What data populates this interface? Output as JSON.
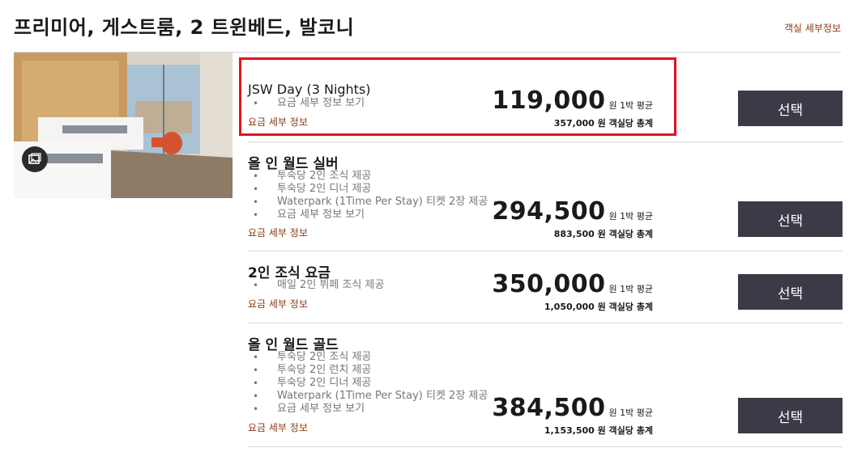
{
  "room": {
    "title": "프리미어, 게스트룸, 2 트윈베드, 발코니",
    "details_link": "객실 세부정보",
    "photo_icon": "gallery-icon"
  },
  "rates": [
    {
      "name": "JSW Day (3 Nights)",
      "inclusions": [
        "요금 세부 정보 보기"
      ],
      "details_link": "요금 세부 정보",
      "price": "119,000",
      "price_unit": "원 1박 평균",
      "total": "357,000 원 객실당 총계",
      "select_label": "선택",
      "highlighted": true
    },
    {
      "name": "올 인 월드 실버",
      "inclusions": [
        "투숙당 2인 조식 제공",
        "투숙당 2인 디너 제공",
        "Waterpark (1Time Per Stay) 티켓 2장 제공",
        "요금 세부 정보 보기"
      ],
      "details_link": "요금 세부 정보",
      "price": "294,500",
      "price_unit": "원 1박 평균",
      "total": "883,500 원 객실당 총계",
      "select_label": "선택"
    },
    {
      "name": "2인 조식 요금",
      "inclusions": [
        "매일 2인 뷔페 조식 제공"
      ],
      "details_link": "요금 세부 정보",
      "price": "350,000",
      "price_unit": "원 1박 평균",
      "total": "1,050,000 원 객실당 총계",
      "select_label": "선택"
    },
    {
      "name": "올 인 월드 골드",
      "inclusions": [
        "투숙당 2인 조식 제공",
        "투숙당 2인 런치 제공",
        "투숙당 2인 디너 제공",
        "Waterpark (1Time Per Stay) 티켓 2장 제공",
        "요금 세부 정보 보기"
      ],
      "details_link": "요금 세부 정보",
      "price": "384,500",
      "price_unit": "원 1박 평균",
      "total": "1,153,500 원 객실당 총계",
      "select_label": "선택"
    }
  ],
  "colors": {
    "accent_link": "#8a3a13",
    "button_bg": "#3d3a47",
    "highlight_border": "#e0141e"
  }
}
